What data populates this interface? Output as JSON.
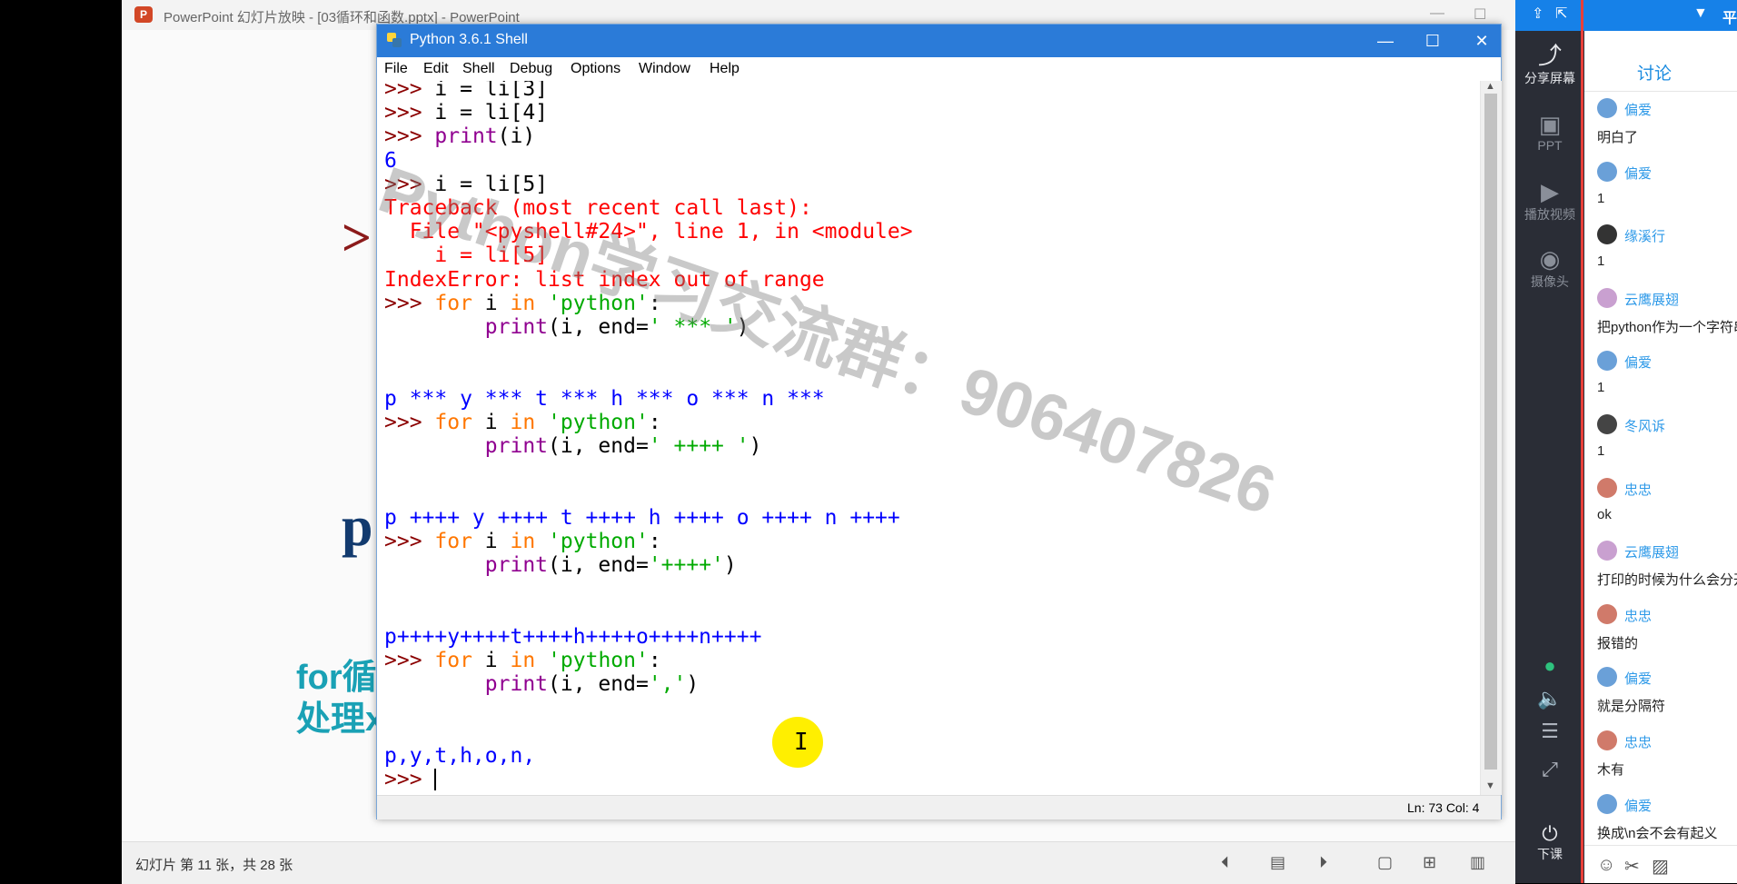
{
  "ppt": {
    "title": "PowerPoint 幻灯片放映 - [03循环和函数.pptx] - PowerPoint",
    "slide_fragments": {
      "gt": ">",
      "p": "p",
      "for_line1": "for循",
      "for_line2": "处理x"
    },
    "status_text": "幻灯片 第 11 张，共 28 张"
  },
  "shell": {
    "title": "Python 3.6.1 Shell",
    "menu": [
      "File",
      "Edit",
      "Shell",
      "Debug",
      "Options",
      "Window",
      "Help"
    ],
    "status": "Ln: 73   Col: 4"
  },
  "watermark": "Python学习交流群：906407826",
  "toolbar": {
    "share": "分享屏幕",
    "ppt": "PPT",
    "video": "播放视频",
    "camera": "摄像头",
    "leave": "下课"
  },
  "chat": {
    "header_label": "平",
    "tab": "讨论",
    "messages": [
      {
        "name": "偏爱",
        "text": "明白了",
        "color": "#6aa0d8"
      },
      {
        "name": "偏爱",
        "text": "1",
        "color": "#6aa0d8"
      },
      {
        "name": "缘溪行",
        "text": "1",
        "color": "#333333"
      },
      {
        "name": "云鹰展翅",
        "text": "把python作为一个字符串",
        "color": "#c9a0d0"
      },
      {
        "name": "偏爱",
        "text": "1",
        "color": "#6aa0d8"
      },
      {
        "name": "冬风诉",
        "text": "1",
        "color": "#444444"
      },
      {
        "name": "忠忠",
        "text": "ok",
        "color": "#d07a6a"
      },
      {
        "name": "云鹰展翅",
        "text": "打印的时候为什么会分开",
        "color": "#c9a0d0"
      },
      {
        "name": "忠忠",
        "text": "报错的",
        "color": "#d07a6a"
      },
      {
        "name": "偏爱",
        "text": "就是分隔符",
        "color": "#6aa0d8"
      },
      {
        "name": "忠忠",
        "text": "木有",
        "color": "#d07a6a"
      },
      {
        "name": "偏爱",
        "text": "换成\\n会不会有起义",
        "color": "#6aa0d8"
      }
    ]
  }
}
